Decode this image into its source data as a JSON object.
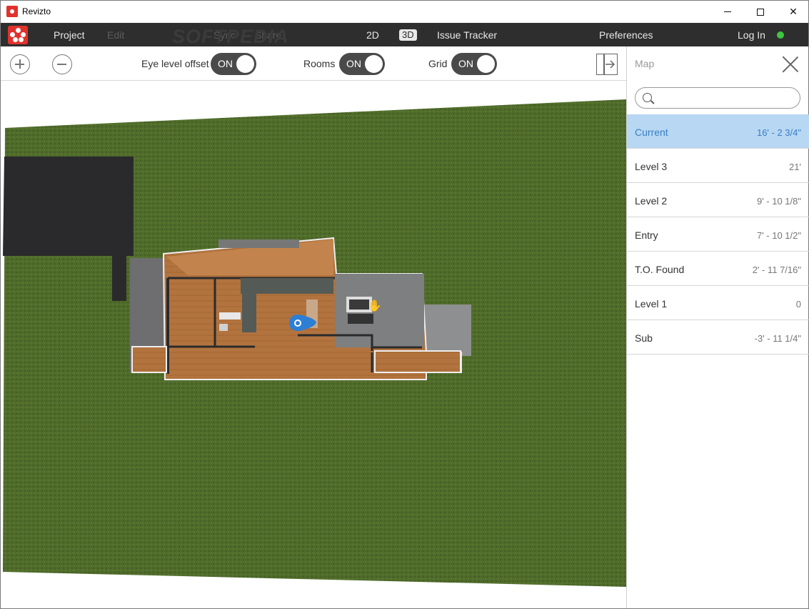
{
  "window": {
    "title": "Revizto"
  },
  "menu": {
    "items": [
      "Project",
      "Edit",
      "Sync",
      "Share"
    ],
    "view_2d": "2D",
    "view_3d": "3D",
    "issue_tracker": "Issue Tracker",
    "preferences": "Preferences",
    "login": "Log In",
    "watermark": "SOFTPEDIA"
  },
  "toolbar": {
    "eye_level_label": "Eye level offset",
    "eye_level_state": "ON",
    "rooms_label": "Rooms",
    "rooms_state": "ON",
    "grid_label": "Grid",
    "grid_state": "ON"
  },
  "panel": {
    "title": "Map",
    "search_placeholder": "",
    "levels": [
      {
        "name": "Current",
        "elevation": "16' - 2 3/4\"",
        "active": true
      },
      {
        "name": "Level 3",
        "elevation": "21'",
        "active": false
      },
      {
        "name": "Level 2",
        "elevation": "9' - 10 1/8\"",
        "active": false
      },
      {
        "name": "Entry",
        "elevation": "7' - 10 1/2\"",
        "active": false
      },
      {
        "name": "T.O. Found",
        "elevation": "2' - 11 7/16\"",
        "active": false
      },
      {
        "name": "Level 1",
        "elevation": "0",
        "active": false
      },
      {
        "name": "Sub",
        "elevation": "-3' - 11 1/4\"",
        "active": false
      }
    ]
  },
  "colors": {
    "accent": "#3a7ec3",
    "active_row": "#b7d7f3",
    "menubar": "#2e2e2e",
    "grass": "#4f6b2a",
    "status_online": "#3fc53f"
  }
}
